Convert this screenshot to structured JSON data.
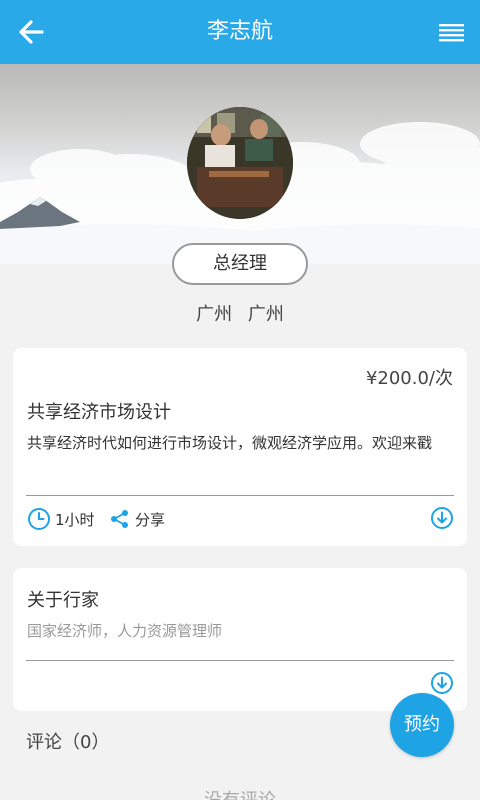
{
  "header": {
    "title": "李志航",
    "back_icon": "arrow-left-icon",
    "menu_icon": "menu-icon"
  },
  "profile": {
    "role": "总经理",
    "location": [
      "广州",
      "广州"
    ]
  },
  "service": {
    "price": "¥200.0/次",
    "title": "共享经济市场设计",
    "description": "共享经济时代如何进行市场设计，微观经济学应用。欢迎来戳",
    "duration": "1小时",
    "share_label": "分享"
  },
  "about": {
    "title": "关于行家",
    "description": "国家经济师，人力资源管理师"
  },
  "comments": {
    "label": "评论（0）",
    "empty_text": "没有评论"
  },
  "book_button": {
    "label": "预约"
  },
  "colors": {
    "accent": "#29a9e8",
    "button": "#1ea3e5",
    "background": "#f2f2f2"
  }
}
